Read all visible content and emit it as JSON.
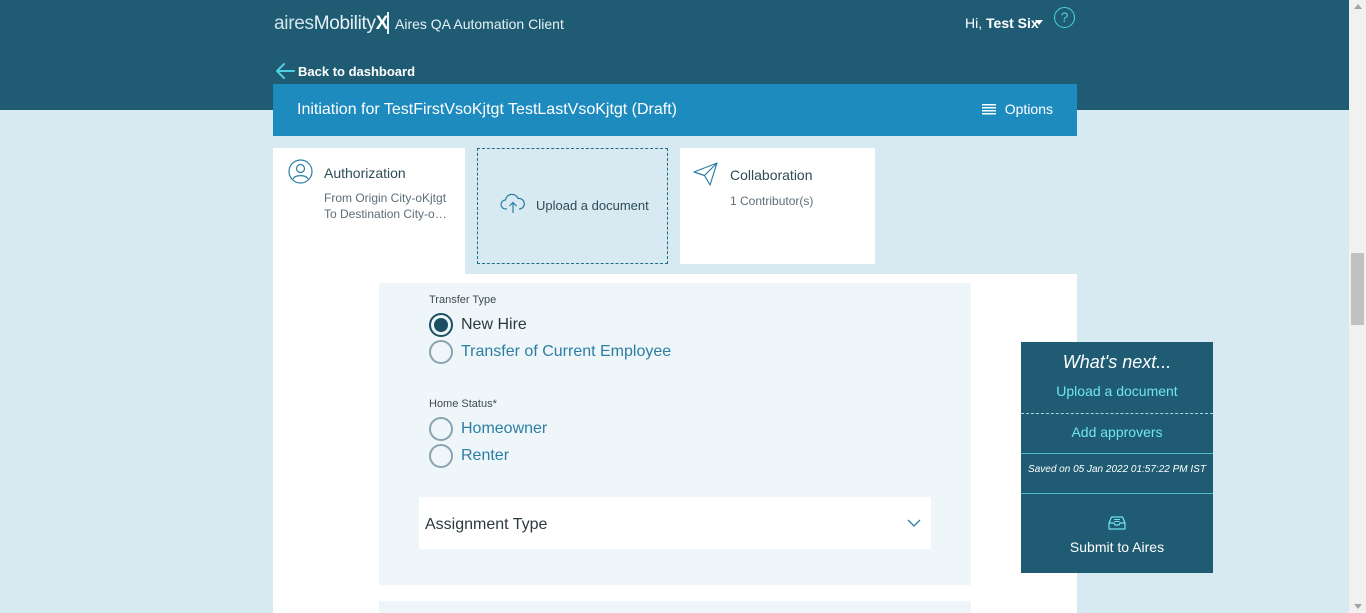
{
  "header": {
    "brand_prefix": "aires",
    "brand_mobility": "Mobility",
    "brand_x": "X",
    "client_name": "Aires QA Automation Client",
    "greeting_prefix": "Hi,",
    "user_name": "Test Six",
    "help_glyph": "?"
  },
  "nav": {
    "back_label": "Back to dashboard"
  },
  "title_bar": {
    "title": "Initiation for TestFirstVsoKjtgt TestLastVsoKjtgt (Draft)",
    "options_label": "Options"
  },
  "cards": {
    "authorization": {
      "title": "Authorization",
      "line1": "From Origin City-oKjtgt",
      "line2": "To Destination City-oKjtgt"
    },
    "upload": {
      "title": "Upload a document"
    },
    "collaboration": {
      "title": "Collaboration",
      "subtitle": "1 Contributor(s)"
    }
  },
  "form": {
    "transfer_type": {
      "label": "Transfer Type",
      "options": [
        "New Hire",
        "Transfer of Current Employee"
      ],
      "selected": "New Hire"
    },
    "home_status": {
      "label": "Home Status*",
      "options": [
        "Homeowner",
        "Renter"
      ],
      "selected": ""
    },
    "assignment_type": {
      "label": "Assignment Type"
    }
  },
  "whats_next": {
    "title": "What's next...",
    "upload_link": "Upload a document",
    "approvers_link": "Add approvers",
    "saved_text": "Saved on 05 Jan 2022 01:57:22 PM IST",
    "submit_label": "Submit to Aires"
  },
  "colors": {
    "header_bg": "#1f5c74",
    "title_bar_bg": "#1e8bbf",
    "accent_cyan": "#6fe3ef",
    "page_bg": "#d7eaf1"
  }
}
